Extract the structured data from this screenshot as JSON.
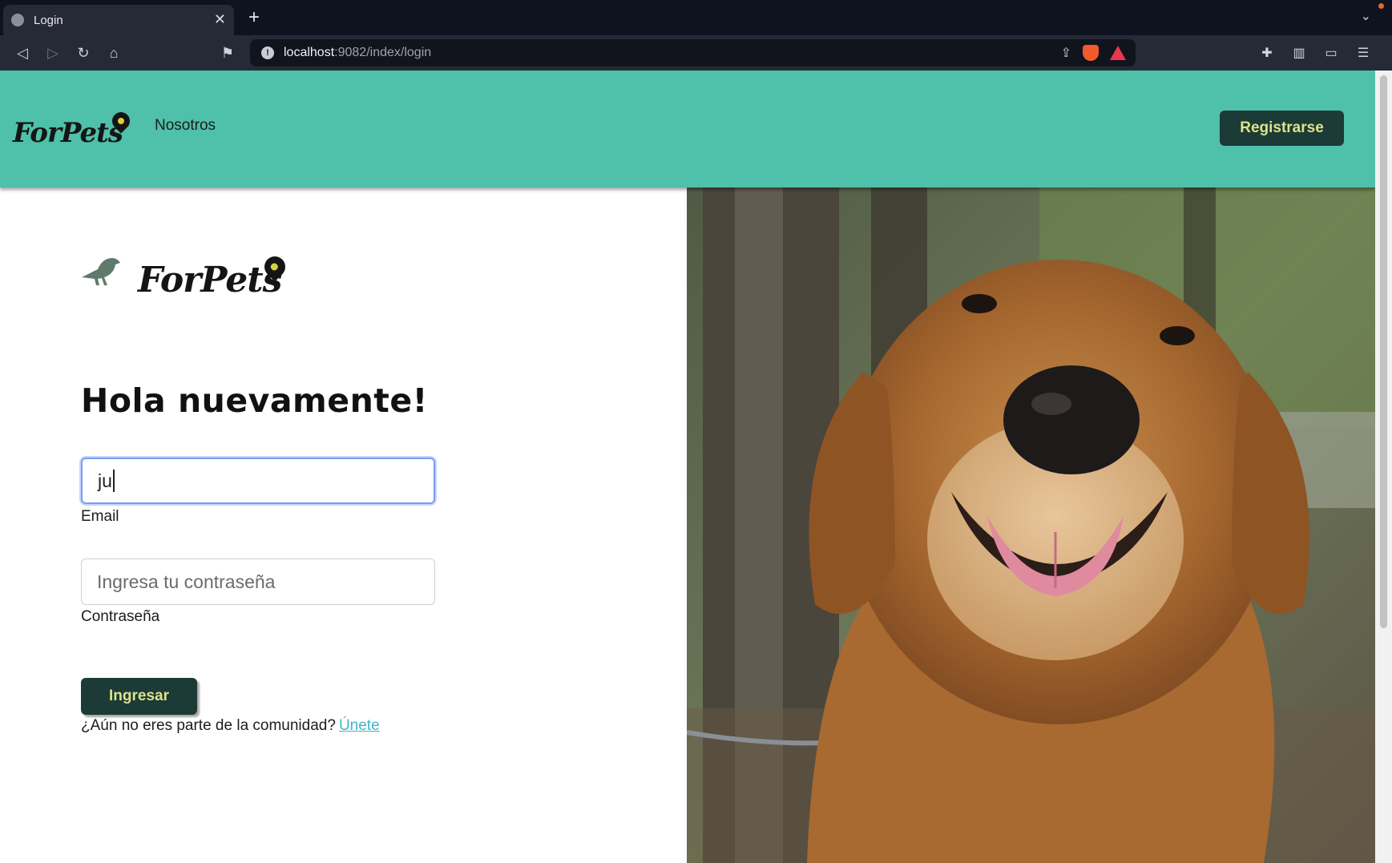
{
  "browser": {
    "tab_title": "Login",
    "url_host": "localhost",
    "url_path": ":9082/index/login"
  },
  "header": {
    "brand": "ForPets",
    "nav_link": "Nosotros",
    "register_label": "Registrarse",
    "accent": "#4fc0a9",
    "button_bg": "#1c3a36",
    "button_text": "#dbe38a"
  },
  "login": {
    "brand": "ForPets",
    "title": "Hola nuevamente!",
    "email_value": "ju",
    "email_label": "Email",
    "password_placeholder": "Ingresa tu contraseña",
    "password_label": "Contraseña",
    "submit_label": "Ingresar",
    "signup_prompt": "¿Aún no eres parte de la comunidad?",
    "signup_link": "Únete"
  }
}
